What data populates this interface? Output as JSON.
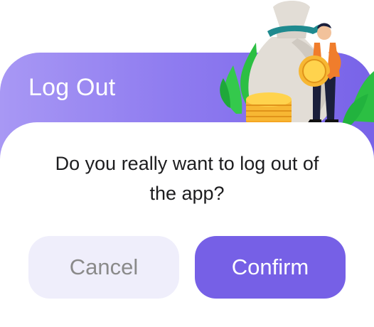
{
  "dialog": {
    "title": "Log Out",
    "message_line1": "Do you really want to log out of",
    "message_line2": "the app?",
    "cancel_label": "Cancel",
    "confirm_label": "Confirm"
  },
  "illustration": {
    "description_icon": "money-bag-illustration-icon"
  },
  "colors": {
    "header_gradient_start": "#a898f4",
    "header_gradient_end": "#7863e8",
    "confirm_bg": "#7660e6",
    "cancel_bg": "#efeefb",
    "cancel_text": "#8a8a8a",
    "message_text": "#1d1d1f"
  }
}
